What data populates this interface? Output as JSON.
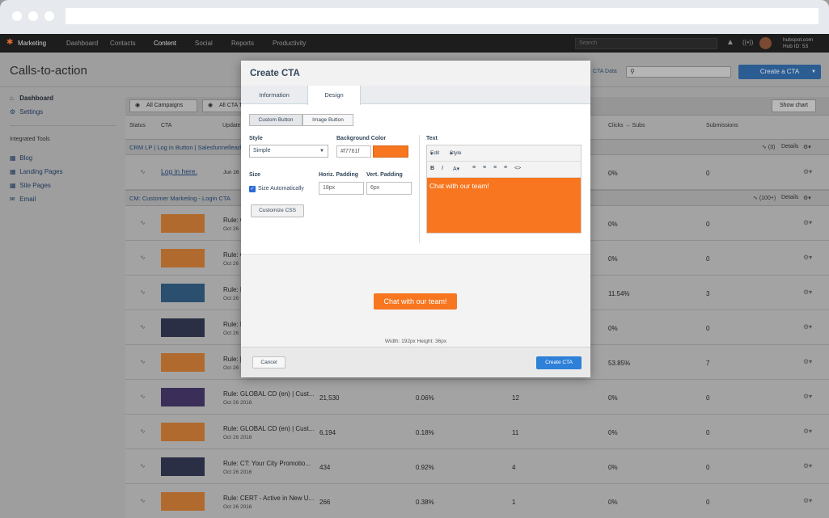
{
  "nav": {
    "items": [
      "Marketing",
      "Dashboard",
      "Contacts",
      "Content",
      "Social",
      "Reports",
      "Productivity"
    ],
    "search_placeholder": "Search",
    "hub_domain": "hubspot.com",
    "hub_id": "Hub ID: 53"
  },
  "page": {
    "title": "Calls-to-action",
    "cta_data_link": "CTA Data",
    "create_button": "Create a CTA"
  },
  "sidebar": {
    "items": [
      {
        "label": "Dashboard",
        "icon": "home-icon"
      },
      {
        "label": "Settings",
        "icon": "gear-icon"
      }
    ],
    "tools_heading": "Integrated Tools",
    "tools": [
      {
        "label": "Blog",
        "icon": "blog-icon"
      },
      {
        "label": "Landing Pages",
        "icon": "page-icon"
      },
      {
        "label": "Site Pages",
        "icon": "page-icon"
      },
      {
        "label": "Email",
        "icon": "email-icon"
      }
    ]
  },
  "filters": {
    "campaigns": "All Campaigns",
    "types": "All CTA Ty",
    "show_chart": "Show chart"
  },
  "columns": {
    "status": "Status",
    "cta": "CTA",
    "updated": "Update",
    "clicks_subs": "Clicks → Subs",
    "submissions": "Submissions"
  },
  "groups": [
    {
      "label": "CRM LP | Log in Button | Salesfunnellead",
      "count": "(3)",
      "details": "Details"
    },
    {
      "label": "CM: Customer Marketing - Login CTA",
      "count": "(100+)",
      "details": "Details"
    }
  ],
  "crm_row": {
    "link": "Log in here.",
    "date": "Jun 16",
    "clicks_subs": "0%",
    "subs": "0"
  },
  "rows": [
    {
      "name": "Rule: G",
      "date": "Oct 26",
      "views": "",
      "rate": "",
      "clicks": "",
      "clicks_subs": "0%",
      "subs": "0"
    },
    {
      "name": "Rule: C",
      "date": "Oct 26",
      "views": "",
      "rate": "",
      "clicks": "",
      "clicks_subs": "0%",
      "subs": "0"
    },
    {
      "name": "Rule: N",
      "date": "Oct 26",
      "views": "",
      "rate": "",
      "clicks": "",
      "clicks_subs": "11.54%",
      "subs": "3"
    },
    {
      "name": "Rule: N",
      "date": "Oct 26",
      "views": "",
      "rate": "",
      "clicks": "",
      "clicks_subs": "0%",
      "subs": "0"
    },
    {
      "name": "Rule: [",
      "date": "Oct 26",
      "views": "",
      "rate": "",
      "clicks": "",
      "clicks_subs": "53.85%",
      "subs": "7"
    },
    {
      "name": "Rule: GLOBAL CD (en) | Cust...",
      "date": "Oct 26 2016",
      "views": "21,530",
      "rate": "0.06%",
      "clicks": "12",
      "clicks_subs": "0%",
      "subs": "0"
    },
    {
      "name": "Rule: GLOBAL CD (en) | Cust...",
      "date": "Oct 26 2016",
      "views": "6,194",
      "rate": "0.18%",
      "clicks": "11",
      "clicks_subs": "0%",
      "subs": "0"
    },
    {
      "name": "Rule: CT: Your City Promotio...",
      "date": "Oct 26 2016",
      "views": "434",
      "rate": "0.92%",
      "clicks": "4",
      "clicks_subs": "0%",
      "subs": "0"
    },
    {
      "name": "Rule: CERT - Active in New U...",
      "date": "Oct 26 2016",
      "views": "266",
      "rate": "0.38%",
      "clicks": "1",
      "clicks_subs": "0%",
      "subs": "0"
    }
  ],
  "modal": {
    "title": "Create CTA",
    "tabs": [
      "Information",
      "Design"
    ],
    "button_types": [
      "Custom Button",
      "Image Button"
    ],
    "style_label": "Style",
    "style_value": "Simple",
    "bg_label": "Background Color",
    "bg_value": "#f7761f",
    "size_label": "Size",
    "hpad_label": "Horiz. Padding",
    "vpad_label": "Vert. Padding",
    "size_auto": "Size Automatically",
    "hpad_value": "18px",
    "vpad_value": "6px",
    "custom_css": "Customize CSS",
    "text_label": "Text",
    "editor_menu": [
      "Edit",
      "Style"
    ],
    "editor_text": "Chat with our team!",
    "preview_text": "Chat with our team!",
    "dims": "Width: 192px  Height: 36px",
    "cancel": "Cancel",
    "create": "Create CTA"
  }
}
